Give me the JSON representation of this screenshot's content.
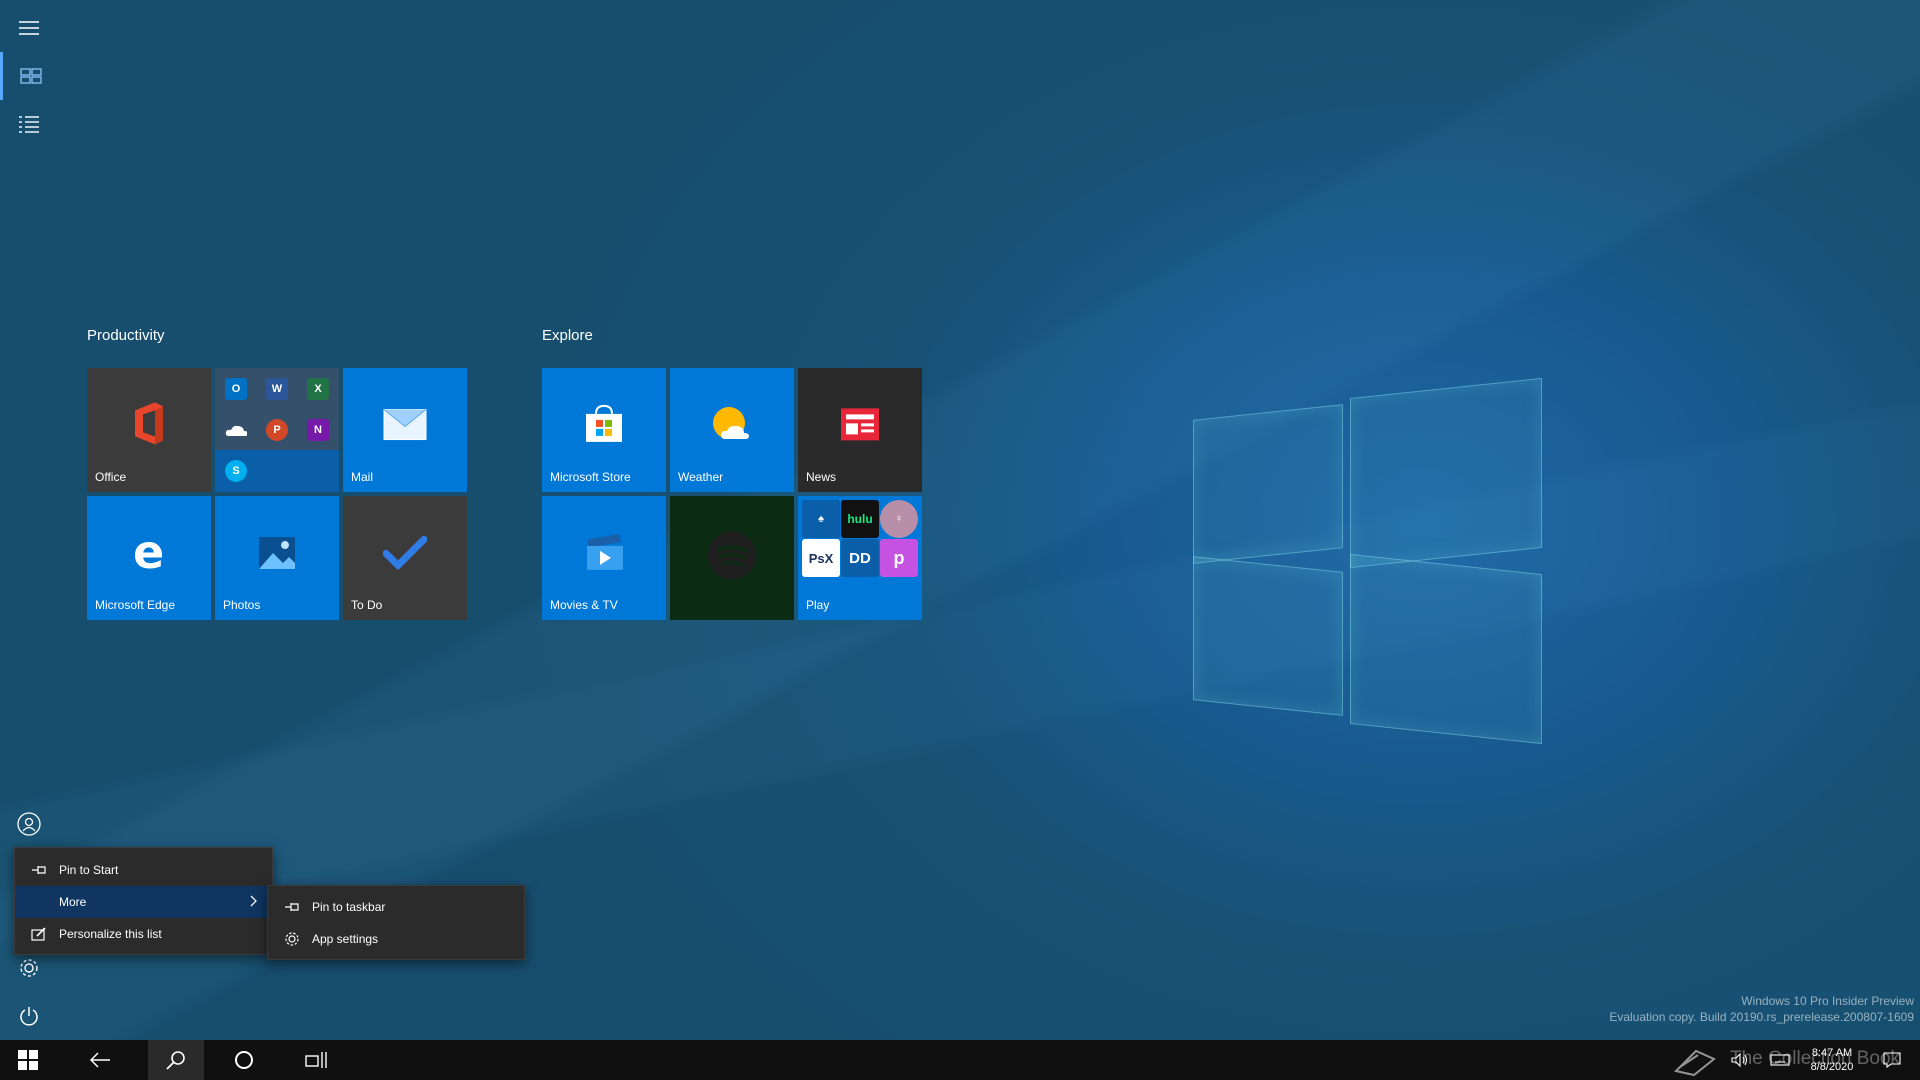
{
  "start_menu": {
    "rail": {
      "items": [
        {
          "name": "hamburger-icon"
        },
        {
          "name": "tiles-view-icon",
          "active": true
        },
        {
          "name": "all-apps-list-icon"
        },
        {
          "name": "user-icon"
        },
        {
          "name": "settings-icon"
        },
        {
          "name": "power-icon"
        }
      ]
    },
    "groups": [
      {
        "title": "Productivity",
        "tiles": [
          {
            "label": "Office",
            "color": "#3b3b3b"
          },
          {
            "label": "",
            "color": "#0a5fa8",
            "icons": [
              "Outlook",
              "Word",
              "Excel",
              "OneDrive",
              "PowerPoint",
              "OneNote",
              "Skype"
            ]
          },
          {
            "label": "Mail",
            "color": "#0078d7"
          },
          {
            "label": "Microsoft Edge",
            "color": "#0078d7"
          },
          {
            "label": "Photos",
            "color": "#0078d7"
          },
          {
            "label": "To Do",
            "color": "#3b3b3b"
          }
        ]
      },
      {
        "title": "Explore",
        "tiles": [
          {
            "label": "Microsoft Store",
            "color": "#0078d7"
          },
          {
            "label": "Weather",
            "color": "#0078d7"
          },
          {
            "label": "News",
            "color": "#2a2a2a"
          },
          {
            "label": "Movies & TV",
            "color": "#0078d7"
          },
          {
            "label": "",
            "color": "#0b2b12"
          },
          {
            "label": "Play",
            "color": "#0078d7",
            "icons": [
              "Solitaire",
              "hulu",
              "Game",
              "PsX",
              "Dolby",
              "PicsArt"
            ]
          }
        ]
      }
    ]
  },
  "context_menu": {
    "items": [
      {
        "label": "Pin to Start",
        "icon": "pin-icon"
      },
      {
        "label": "More",
        "icon": "",
        "submenu": true,
        "highlighted": true
      },
      {
        "label": "Personalize this list",
        "icon": "personalize-icon"
      }
    ]
  },
  "submenu": {
    "items": [
      {
        "label": "Pin to taskbar",
        "icon": "pin-icon"
      },
      {
        "label": "App settings",
        "icon": "gear-icon"
      }
    ]
  },
  "watermark": {
    "line1": "Windows 10 Pro Insider Preview",
    "line2": "Evaluation copy. Build 20190.rs_prerelease.200807-1609"
  },
  "taskbar": {
    "items": [
      "start-button",
      "back-button",
      "search-button",
      "cortana-button",
      "task-view-button"
    ],
    "clock": {
      "time": "8:47 AM",
      "date": "8/8/2020"
    },
    "overlay_text": "The Collection Book"
  },
  "colors": {
    "tile_blue": "#0078d7",
    "accent": "#5aa8ff",
    "taskbar": "#101010"
  }
}
